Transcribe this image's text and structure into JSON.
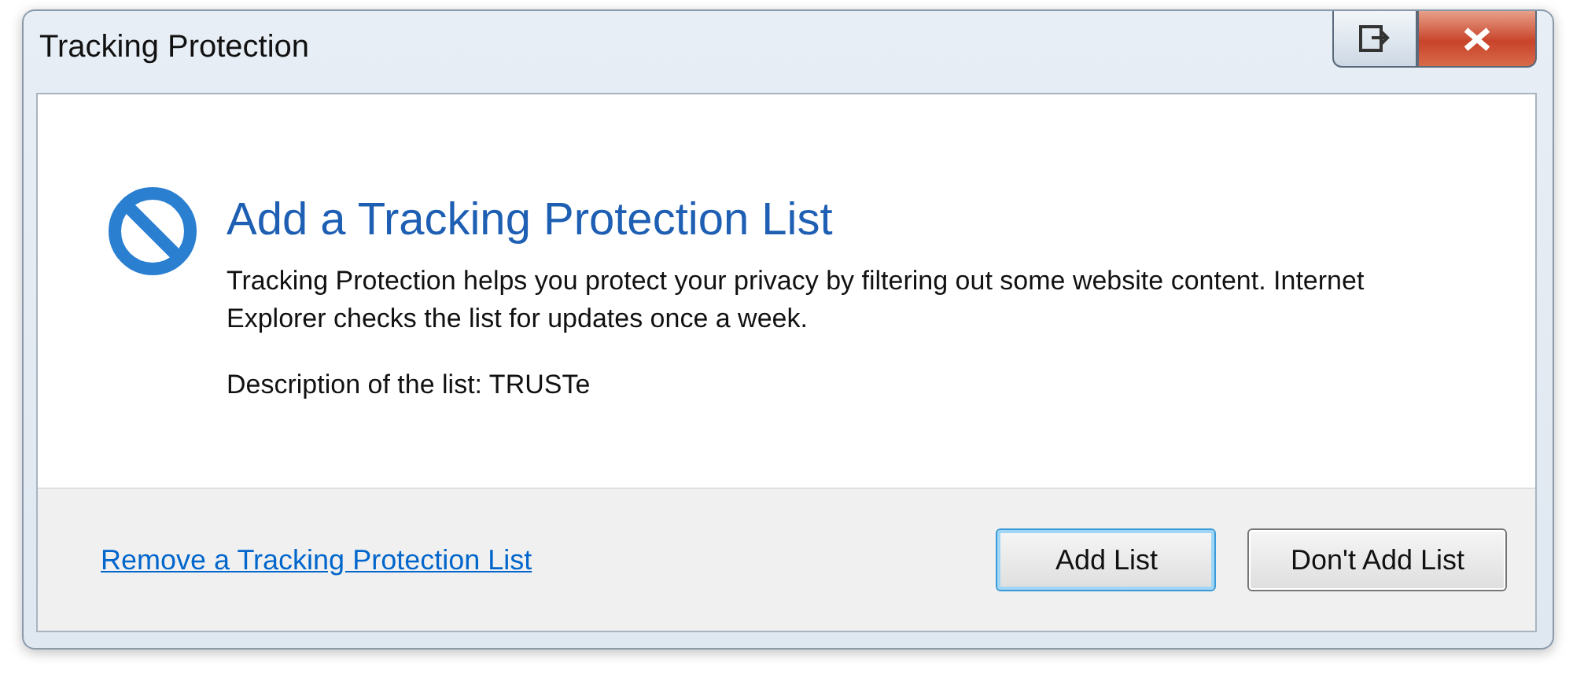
{
  "window": {
    "title": "Tracking Protection"
  },
  "heading": "Add a Tracking Protection List",
  "body": "Tracking Protection helps you protect your privacy by filtering out some website content. Internet Explorer checks the list for updates once a week.",
  "description": "Description of the list: TRUSTe",
  "footer": {
    "link": "Remove a Tracking Protection List",
    "buttons": [
      {
        "label": "Add List",
        "default": true
      },
      {
        "label": "Don't Add List",
        "default": false
      }
    ]
  }
}
